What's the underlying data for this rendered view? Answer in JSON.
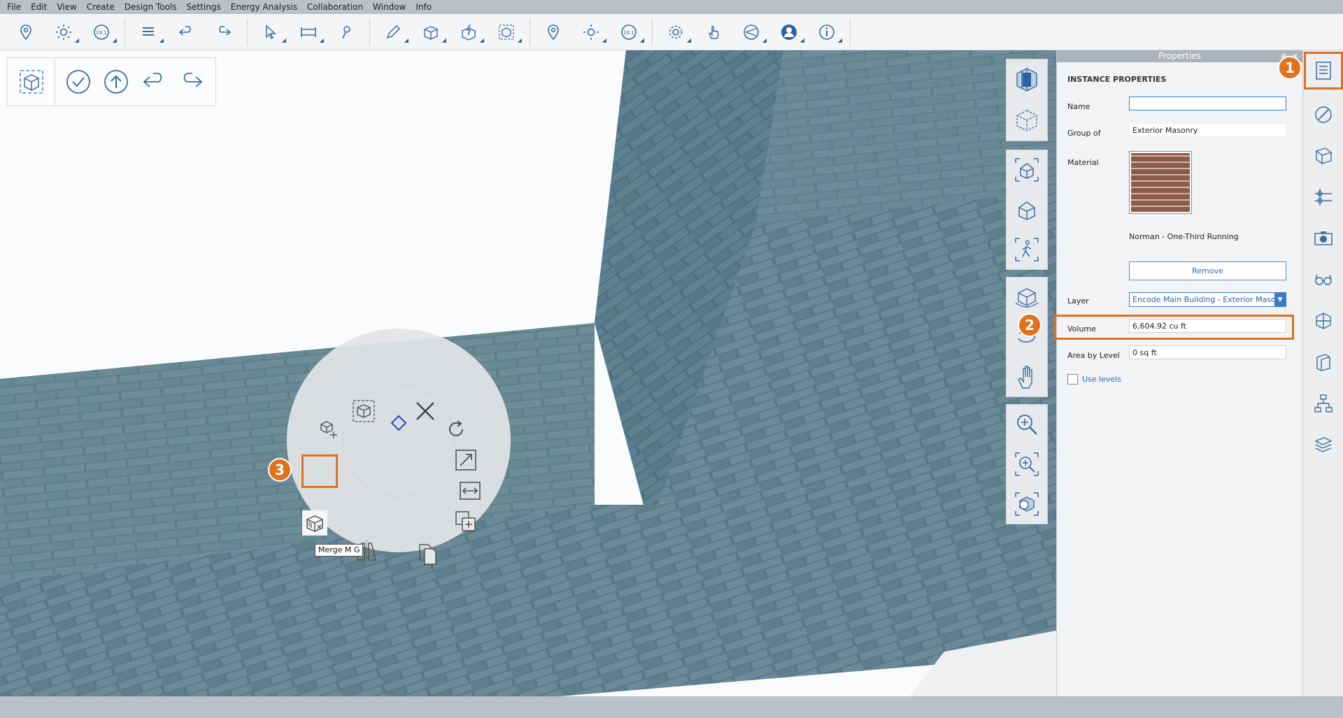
{
  "menu": [
    "File",
    "Edit",
    "View",
    "Create",
    "Design Tools",
    "Settings",
    "Energy Analysis",
    "Collaboration",
    "Window",
    "Info"
  ],
  "toolbar": {
    "groups": [
      [
        "location-pin-icon",
        "sun-icon",
        "date-icon"
      ],
      [
        "layers-list-icon",
        "undo-icon",
        "redo-icon"
      ],
      [
        "select-arrow-icon",
        "dimension-icon",
        "push-pin-icon"
      ],
      [
        "draw-pencil-icon",
        "add-box-icon",
        "quick-shape-icon",
        "group-box-icon"
      ],
      [
        "location-pin-icon",
        "sun-icon",
        "date-icon"
      ],
      [
        "settings-gear-icon",
        "touch-hand-icon",
        "sharing-icon",
        "account-icon",
        "info-icon"
      ]
    ],
    "date_badge": "19.1"
  },
  "edit_bar": [
    "edit-mode-icon",
    "check-icon",
    "up-arrow-icon",
    "undo-icon",
    "redo-icon"
  ],
  "nav": {
    "group1": [
      "view-cube-icon",
      "section-view-icon"
    ],
    "group2": [
      "3d-house-icon",
      "house-icon",
      "walk-person-icon"
    ],
    "group3": [
      "orbit-icon",
      "rotate-icon",
      "pan-hand-icon"
    ],
    "group4": [
      "zoom-in-icon",
      "zoom-extents-icon",
      "zoom-object-icon"
    ]
  },
  "radial_menu": {
    "items": [
      "group-icon",
      "ungroup-icon",
      "delete-x-icon",
      "rotate-icon",
      "scale-icon",
      "stretch-icon",
      "copy-icon",
      "duplicate-icon",
      "mirror-icon",
      "merge-icon",
      "move-icon"
    ],
    "tooltip": "Merge   M G"
  },
  "callouts": [
    "1",
    "2",
    "3"
  ],
  "properties": {
    "title": "Properties",
    "pin": "⊕",
    "close": "✕",
    "section": "INSTANCE PROPERTIES",
    "name_label": "Name",
    "name_value": "",
    "group_label": "Group of",
    "group_value": "Exterior Masonry",
    "material_label": "Material",
    "material_name": "Norman - One-Third Running",
    "remove_label": "Remove",
    "layer_label": "Layer",
    "layer_value": "Encode Main Building - Exterior Masonry",
    "volume_label": "Volume",
    "volume_value": "6,604.92 cu ft",
    "area_label": "Area by Level",
    "area_value": "0 sq ft",
    "use_levels_label": "Use levels"
  },
  "right_sidebar": [
    "properties-panel-icon",
    "styles-icon",
    "materials-icon",
    "levels-icon",
    "camera-icon",
    "glasses-icon",
    "walls-icon",
    "doors-icon",
    "hierarchy-icon",
    "layers-icon"
  ],
  "colors": {
    "accent": "#e2711d",
    "brand": "#2f6bb4"
  }
}
